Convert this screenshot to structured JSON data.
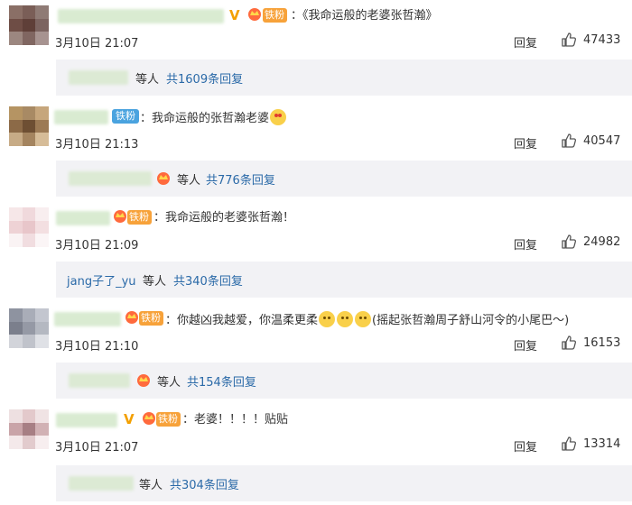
{
  "comments": [
    {
      "text": "：《我命运般的老婆张哲瀚》",
      "time": "3月10日 21:07",
      "reply_label": "回复",
      "likes": "47433",
      "replies": {
        "suffix": "等人",
        "count_text": "共1609条回复"
      }
    },
    {
      "fan_badge": "铁粉",
      "text": "：我命运般的张哲瀚老婆",
      "time": "3月10日 21:13",
      "reply_label": "回复",
      "likes": "40547",
      "replies": {
        "suffix": "等人",
        "count_text": "共776条回复"
      }
    },
    {
      "fan_badge": "铁粉",
      "text": "：我命运般的老婆张哲瀚！",
      "time": "3月10日 21:09",
      "reply_label": "回复",
      "likes": "24982",
      "replies": {
        "name": "jang子了_yu",
        "suffix": "等人",
        "count_text": "共340条回复"
      }
    },
    {
      "fan_badge": "铁粉",
      "text_a": "：你越凶我越爱，你温柔更柔",
      "text_b": "(摇起张哲瀚周子舒山河令的小尾巴～)",
      "time": "3月10日 21:10",
      "reply_label": "回复",
      "likes": "16153",
      "replies": {
        "suffix": "等人",
        "count_text": "共154条回复"
      }
    },
    {
      "fan_badge": "铁粉",
      "text": "：老婆！！！！贴贴",
      "time": "3月10日 21:07",
      "reply_label": "回复",
      "likes": "13314",
      "replies": {
        "suffix": "等人",
        "count_text": "共304条回复"
      }
    }
  ],
  "colors": {
    "link": "#2b6aa8",
    "vip": "#f3a000",
    "fan_badge": "#f7a23a",
    "fan_badge_blue": "#4aa3df",
    "reply_bg": "#f2f2f5"
  },
  "icons": {
    "like": "thumbs-up-icon",
    "vip": "vip-v-icon",
    "crown": "crown-badge-icon"
  }
}
